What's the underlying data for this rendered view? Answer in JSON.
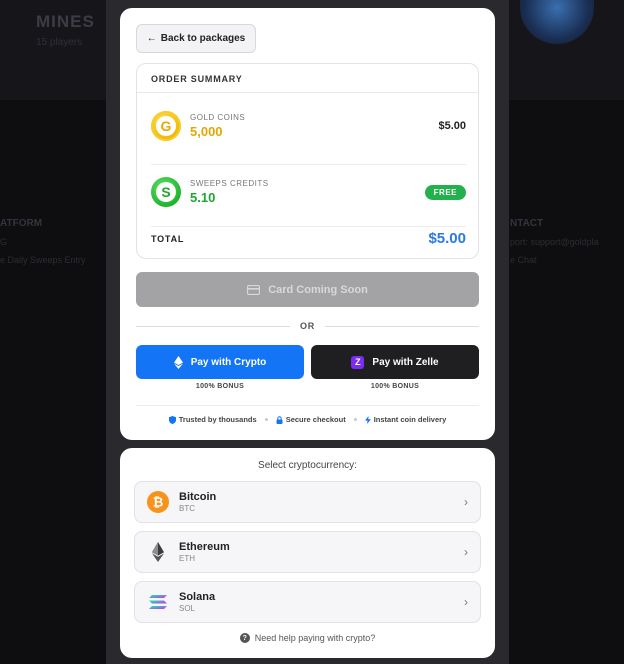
{
  "background": {
    "game_title": "MINES",
    "game_subtitle": "15 players",
    "col_left_heading": "ATFORM",
    "col_left_items": [
      "G",
      "e Daily Sweeps Entry"
    ],
    "col_right_heading": "NTACT",
    "col_right_items": [
      "port: support@goldpla",
      "e Chat"
    ]
  },
  "back_button": {
    "label": "Back to packages"
  },
  "order_summary": {
    "heading": "ORDER SUMMARY",
    "items": [
      {
        "label": "GOLD COINS",
        "amount": "5,000",
        "price": "$5.00",
        "icon": "G"
      },
      {
        "label": "SWEEPS CREDITS",
        "amount": "5.10",
        "badge": "FREE",
        "icon": "S"
      }
    ],
    "total_label": "TOTAL",
    "total_value": "$5.00"
  },
  "card_button": {
    "label": "Card Coming Soon"
  },
  "or_label": "OR",
  "pay_crypto": {
    "label": "Pay with Crypto",
    "bonus": "100% BONUS"
  },
  "pay_zelle": {
    "label": "Pay with Zelle",
    "icon_letter": "Z",
    "bonus": "100% BONUS"
  },
  "trust": [
    {
      "label": "Trusted by thousands"
    },
    {
      "label": "Secure checkout"
    },
    {
      "label": "Instant coin delivery"
    }
  ],
  "crypto_select": {
    "title": "Select cryptocurrency:",
    "options": [
      {
        "name": "Bitcoin",
        "symbol": "BTC"
      },
      {
        "name": "Ethereum",
        "symbol": "ETH"
      },
      {
        "name": "Solana",
        "symbol": "SOL"
      }
    ],
    "help": "Need help paying with crypto?"
  },
  "colors": {
    "primary_blue": "#1374f5",
    "gold": "#e4a600",
    "green": "#1fa534",
    "total_blue": "#2a7bdc",
    "zelle_purple": "#7b2cf0"
  }
}
